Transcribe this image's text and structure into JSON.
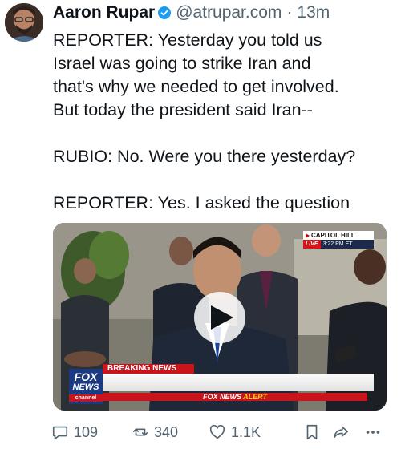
{
  "author": {
    "name": "Aaron Rupar",
    "handle": "@atrupar.com",
    "separator": "·",
    "time": "13m"
  },
  "tweet": {
    "lines": [
      "REPORTER: Yesterday you told us",
      "Israel was going to strike Iran and",
      "that's why we needed to get involved.",
      "But today the president said Iran--",
      "",
      "RUBIO: No. Were you there yesterday?",
      "",
      "REPORTER: Yes. I asked the question"
    ]
  },
  "video": {
    "location": "CAPITOL HILL",
    "live_label": "LIVE",
    "time_label": "3:22 PM ET",
    "breaking_label": "BREAKING NEWS",
    "logo_line1": "FOX",
    "logo_line2": "NEWS",
    "logo_line3": "channel",
    "alert_prefix": "FOX NEWS",
    "alert_word": "ALERT"
  },
  "actions": {
    "replies": "109",
    "reposts": "340",
    "likes": "1.1K"
  },
  "colors": {
    "text": "#0f1419",
    "secondary": "#536471",
    "verified": "#1d9bf0",
    "fox_red": "#c8141a",
    "fox_blue": "#1b3a82"
  },
  "icons": [
    "verified-icon",
    "play-icon",
    "reply-icon",
    "repost-icon",
    "like-icon",
    "bookmark-icon",
    "share-icon",
    "more-icon"
  ]
}
